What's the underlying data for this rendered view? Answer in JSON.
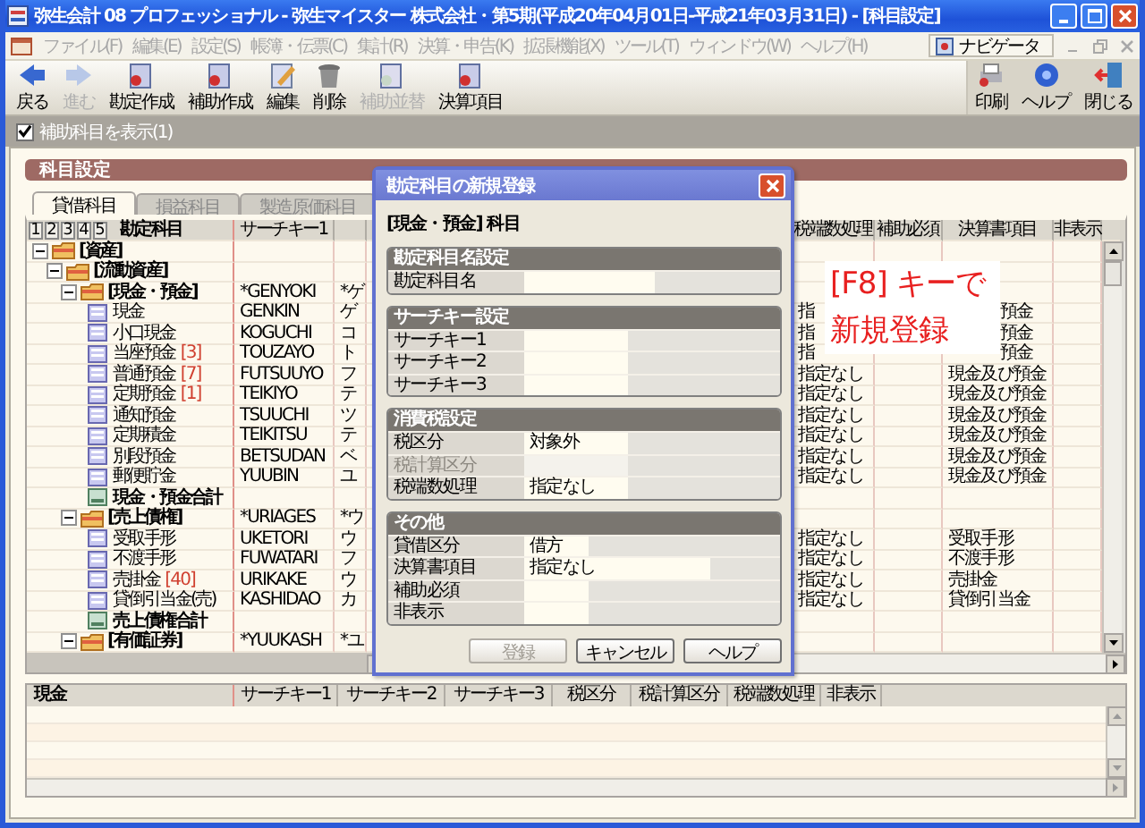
{
  "window": {
    "title": "弥生会計 08 プロフェッショナル - 弥生マイスター 株式会社・第5期(平成20年04月01日-平成21年03月31日) - [科目設定]"
  },
  "menu": [
    "ファイル(F)",
    "編集(E)",
    "設定(S)",
    "帳簿・伝票(C)",
    "集計(R)",
    "決算・申告(K)",
    "拡張機能(X)",
    "ツール(T)",
    "ウィンドウ(W)",
    "ヘルプ(H)"
  ],
  "navigator": {
    "label": "ナビゲータ"
  },
  "toolbar": {
    "left": [
      {
        "label": "戻る",
        "disabled": false
      },
      {
        "label": "進む",
        "disabled": true
      },
      {
        "label": "勘定作成",
        "disabled": false
      },
      {
        "label": "補助作成",
        "disabled": false
      },
      {
        "label": "編集",
        "disabled": false
      },
      {
        "label": "削除",
        "disabled": false
      },
      {
        "label": "補助並替",
        "disabled": true
      },
      {
        "label": "決算項目",
        "disabled": false
      }
    ],
    "right": [
      {
        "label": "印刷",
        "disabled": false
      },
      {
        "label": "ヘルプ",
        "disabled": false
      },
      {
        "label": "閉じる",
        "disabled": false
      }
    ]
  },
  "show_sub": {
    "label": "補助科目を表示(1)",
    "checked": true
  },
  "panel": {
    "title": "科目設定"
  },
  "tabs": [
    {
      "label": "貸借科目",
      "selected": true
    },
    {
      "label": "損益科目",
      "selected": false
    },
    {
      "label": "製造原価科目",
      "selected": false
    }
  ],
  "grid": {
    "levels": [
      "1",
      "2",
      "3",
      "4",
      "5"
    ],
    "columns": {
      "account": "勘定科目",
      "key1": "サーチキー1",
      "tax": "税端数処理",
      "hojo": "補助必須",
      "kessan": "決算書項目",
      "hidden": "非表示"
    },
    "tree": [
      {
        "label": "[資産]",
        "kind": "group",
        "expanded": true,
        "children": [
          {
            "label": "[流動資産]",
            "kind": "group",
            "expanded": true,
            "children": [
              {
                "label": "[現金・預金]",
                "kind": "group",
                "expanded": true,
                "key1": "*GENYOKI",
                "key2": "*ゲ",
                "children": [
                  {
                    "label": "現金",
                    "kind": "item",
                    "key1": "GENKIN",
                    "key2": "ゲ",
                    "tax": "指",
                    "kessan": "預金",
                    "obscured": true
                  },
                  {
                    "label": "小口現金",
                    "kind": "item",
                    "key1": "KOGUCHI",
                    "key2": "コ",
                    "tax": "指",
                    "kessan": "預金",
                    "obscured": true
                  },
                  {
                    "label": "当座預金",
                    "kind": "item",
                    "count": "[3]",
                    "key1": "TOUZAYO",
                    "key2": "ト",
                    "tax": "指",
                    "kessan": "預金",
                    "obscured": true
                  },
                  {
                    "label": "普通預金",
                    "kind": "item",
                    "count": "[7]",
                    "key1": "FUTSUUYO",
                    "key2": "フ",
                    "tax": "指定なし",
                    "kessan": "現金及び預金",
                    "obscured": false
                  },
                  {
                    "label": "定期預金",
                    "kind": "item",
                    "count": "[1]",
                    "key1": "TEIKIYO",
                    "key2": "テ",
                    "tax": "指定なし",
                    "kessan": "現金及び預金",
                    "obscured": false
                  },
                  {
                    "label": "通知預金",
                    "kind": "item",
                    "key1": "TSUUCHI",
                    "key2": "ツ",
                    "tax": "指定なし",
                    "kessan": "現金及び預金",
                    "obscured": false
                  },
                  {
                    "label": "定期積金",
                    "kind": "item",
                    "key1": "TEIKITSU",
                    "key2": "テ",
                    "tax": "指定なし",
                    "kessan": "現金及び預金",
                    "obscured": false
                  },
                  {
                    "label": "別段預金",
                    "kind": "item",
                    "key1": "BETSUDAN",
                    "key2": "ベ",
                    "tax": "指定なし",
                    "kessan": "現金及び預金",
                    "obscured": false
                  },
                  {
                    "label": "郵便貯金",
                    "kind": "item",
                    "key1": "YUUBIN",
                    "key2": "ユ",
                    "tax": "指定なし",
                    "kessan": "現金及び預金",
                    "obscured": false
                  },
                  {
                    "label": "現金・預金合計",
                    "kind": "total"
                  }
                ]
              },
              {
                "label": "[売上債権]",
                "kind": "group",
                "expanded": true,
                "key1": "*URIAGES",
                "key2": "*ウ",
                "children": [
                  {
                    "label": "受取手形",
                    "kind": "item",
                    "key1": "UKETORI",
                    "key2": "ウ",
                    "tax": "指定なし",
                    "kessan": "受取手形",
                    "obscured": false
                  },
                  {
                    "label": "不渡手形",
                    "kind": "item",
                    "key1": "FUWATARI",
                    "key2": "フ",
                    "tax": "指定なし",
                    "kessan": "不渡手形",
                    "obscured": false
                  },
                  {
                    "label": "売掛金",
                    "kind": "item",
                    "count": "[40]",
                    "key1": "URIKAKE",
                    "key2": "ウ",
                    "tax": "指定なし",
                    "kessan": "売掛金",
                    "obscured": false
                  },
                  {
                    "label": "貸倒引当金(売)",
                    "kind": "item",
                    "key1": "KASHIDAO",
                    "key2": "カ",
                    "tax": "指定なし",
                    "kessan": "貸倒引当金",
                    "obscured": false
                  },
                  {
                    "label": "売上債権合計",
                    "kind": "total"
                  }
                ]
              },
              {
                "label": "[有価証券]",
                "kind": "group",
                "expanded": true,
                "key1": "*YUUKASH",
                "key2": "*ユ"
              }
            ]
          }
        ]
      }
    ]
  },
  "annotation": {
    "lines": [
      "[F8] キーで",
      "新規登録"
    ]
  },
  "detail": {
    "columns": [
      "現金",
      "サーチキー1",
      "サーチキー2",
      "サーチキー3",
      "税区分",
      "税計算区分",
      "税端数処理",
      "非表示"
    ]
  },
  "dialog": {
    "title": "勘定科目の新規登録",
    "heading": "[現金・預金] 科目",
    "sections": [
      {
        "title": "勘定科目名設定",
        "fields": [
          {
            "label": "勘定科目名",
            "kind": "full",
            "disabled": false
          }
        ]
      },
      {
        "title": "サーチキー設定",
        "fields": [
          {
            "label": "サーチキー1",
            "kind": "normal",
            "disabled": false
          },
          {
            "label": "サーチキー2",
            "kind": "normal",
            "disabled": false
          },
          {
            "label": "サーチキー3",
            "kind": "normal",
            "disabled": false
          }
        ]
      },
      {
        "title": "消費税設定",
        "fields": [
          {
            "label": "税区分",
            "value": "対象外",
            "kind": "normal",
            "disabled": false
          },
          {
            "label": "税計算区分",
            "kind": "normal",
            "disabled": true
          },
          {
            "label": "税端数処理",
            "value": "指定なし",
            "kind": "normal",
            "disabled": false
          }
        ]
      },
      {
        "title": "その他",
        "fields": [
          {
            "label": "貸借区分",
            "value": "借方",
            "kind": "narrow",
            "disabled": false
          },
          {
            "label": "決算書項目",
            "value": "指定なし",
            "kind": "wide",
            "disabled": false
          },
          {
            "label": "補助必須",
            "kind": "narrow",
            "disabled": false
          },
          {
            "label": "非表示",
            "kind": "narrow",
            "disabled": false
          }
        ]
      }
    ],
    "buttons": [
      {
        "label": "登録",
        "disabled": true
      },
      {
        "label": "キャンセル",
        "disabled": false
      },
      {
        "label": "ヘルプ",
        "disabled": false
      }
    ]
  }
}
